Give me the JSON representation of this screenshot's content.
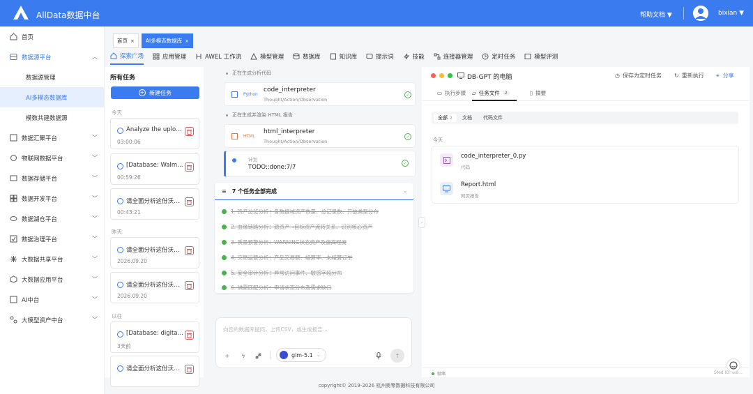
{
  "header": {
    "title": "AllData数据中台",
    "help_label": "帮助文档 ▼",
    "username": "bixian ▼"
  },
  "sidebar": {
    "items": [
      {
        "label": "首页",
        "icon": "home-icon"
      },
      {
        "label": "数据源平台",
        "icon": "database-icon",
        "expanded": true
      },
      {
        "label": "数据汇聚平台",
        "icon": "collect-icon"
      },
      {
        "label": "物联网数据平台",
        "icon": "iot-icon"
      },
      {
        "label": "数据存储平台",
        "icon": "storage-icon"
      },
      {
        "label": "数据开发平台",
        "icon": "dev-icon"
      },
      {
        "label": "数据湖仓平台",
        "icon": "lake-icon"
      },
      {
        "label": "数据治理平台",
        "icon": "governance-icon"
      },
      {
        "label": "大数据共享平台",
        "icon": "share-icon"
      },
      {
        "label": "大数据应用平台",
        "icon": "app-icon"
      },
      {
        "label": "AI中台",
        "icon": "ai-icon"
      },
      {
        "label": "大模型资产中台",
        "icon": "model-asset-icon"
      }
    ],
    "subitems": [
      "数据源管理",
      "AI多模态数据库",
      "模数共建数据源"
    ]
  },
  "tabs": [
    {
      "label": "首页",
      "close": "×"
    },
    {
      "label": "AI多模态数据库",
      "close": "×"
    }
  ],
  "navtabs": [
    "探索广场",
    "应用管理",
    "AWEL 工作流",
    "模型管理",
    "数据库",
    "知识库",
    "提示词",
    "技能",
    "连接器管理",
    "定时任务",
    "模型评测"
  ],
  "tasks": {
    "title": "所有任务",
    "new_button": "新建任务",
    "groups": [
      {
        "label": "今天",
        "items": [
          {
            "name": "Analyze the uploa…",
            "time": "03:00:06"
          },
          {
            "name": "[Database: Walma…",
            "time": "00:59:26"
          },
          {
            "name": "请全面分析这份沃…",
            "time": "00:43:21"
          }
        ]
      },
      {
        "label": "昨天",
        "items": [
          {
            "name": "请全面分析这份沃…",
            "time": "2026.09.20"
          },
          {
            "name": "请全面分析这份沃…",
            "time": "2026.09.20"
          }
        ]
      },
      {
        "label": "以往",
        "items": [
          {
            "name": "[Database: digital…",
            "time": "3天前"
          },
          {
            "name": "请全面分析这份沃…",
            "time": ""
          }
        ]
      }
    ]
  },
  "mid": {
    "status1": "正在生成分析代码",
    "tool1": {
      "lang": "Python",
      "name": "code_interpreter",
      "sub": "Thought/Action/Observation"
    },
    "status2": "正在生成并渲染 HTML 报告",
    "tool2": {
      "lang": "HTML",
      "name": "html_interpreter",
      "sub": "Thought/Action/Observation"
    },
    "plan": {
      "label": "计划",
      "value": "TODO::done:7/7"
    },
    "todo_title": "7 个任务全部完成",
    "todo_items": [
      "1. 资产总览分析：各数据域资产数量、总记录数、开放类型分布",
      "2. 血缘链路分析：源资产→目标资产流转关系、识别核心资产",
      "3. 质量预警分析：WARNING状态资产及偏离程度",
      "4. 交易运营分析：产品交易额、结算率、未结算订单",
      "5. 安全审计分析：异常访问事件、敏感字段分布",
      "6. 供需匹配分析：申请状态分布及需求缺口"
    ],
    "input_placeholder": "向您的数据库提问，上传CSV，或生成报告...",
    "model": "glm-5.1"
  },
  "right": {
    "title": "DB-GPT 的电脑",
    "save_schedule": "保存为定时任务",
    "rerun": "重新执行",
    "share": "分享",
    "tabs": [
      {
        "label": "执行步骤",
        "count": ""
      },
      {
        "label": "任务文件",
        "count": "2"
      },
      {
        "label": "摘要",
        "count": ""
      }
    ],
    "filters": [
      {
        "label": "全部",
        "count": "2"
      },
      {
        "label": "文档",
        "count": ""
      },
      {
        "label": "代码文件",
        "count": ""
      }
    ],
    "group_label": "今天",
    "files": [
      {
        "name": "code_interpreter_0.py",
        "type": "代码",
        "icon": "terminal-icon",
        "color": "#9b59b6"
      },
      {
        "name": "Report.html",
        "type": "网页报告",
        "icon": "monitor-icon",
        "color": "#3a7bf0"
      }
    ],
    "status": "就绪",
    "sid": "Sted ID: ste…"
  },
  "footer": "copyright© 2019-2026 杭州奥零数据科技有限公司",
  "colors": {
    "primary": "#3a7bf0",
    "success": "#4caf50",
    "danger": "#e25555"
  }
}
